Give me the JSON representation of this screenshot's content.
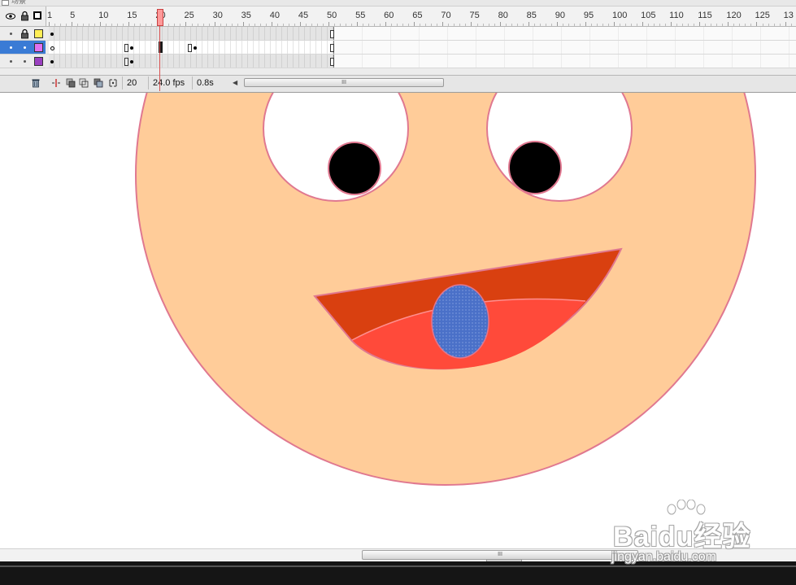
{
  "title_strip": {
    "tab_label": "场景"
  },
  "timeline": {
    "ruler_labels": [
      "1",
      "5",
      "10",
      "15",
      "20",
      "25",
      "30",
      "35",
      "40",
      "45",
      "50",
      "55",
      "60",
      "65",
      "70",
      "75",
      "80",
      "85",
      "90",
      "95",
      "100",
      "105",
      "110",
      "115",
      "120",
      "125",
      "13"
    ],
    "layers": [
      {
        "swatch_color": "#ffee55",
        "selected": false
      },
      {
        "swatch_color": "#e070f0",
        "selected": true
      },
      {
        "swatch_color": "#9a40c0",
        "selected": false
      }
    ],
    "footer": {
      "current_frame": "20",
      "frame_rate": "24.0 fps",
      "elapsed_time": "0.8s",
      "scroll_grip": "III"
    }
  },
  "stage": {
    "face_color": "#ffcc99",
    "outline_color": "#e07890",
    "mouth_dark_color": "#d94010",
    "mouth_light_color": "#ff4a3a",
    "tongue_color": "#4a70c8",
    "pupil_color": "#000000"
  },
  "bottom_scroll": {
    "grip": "III"
  },
  "watermark": {
    "brand": "Baidu经验",
    "url": "jingyan.baidu.com"
  }
}
